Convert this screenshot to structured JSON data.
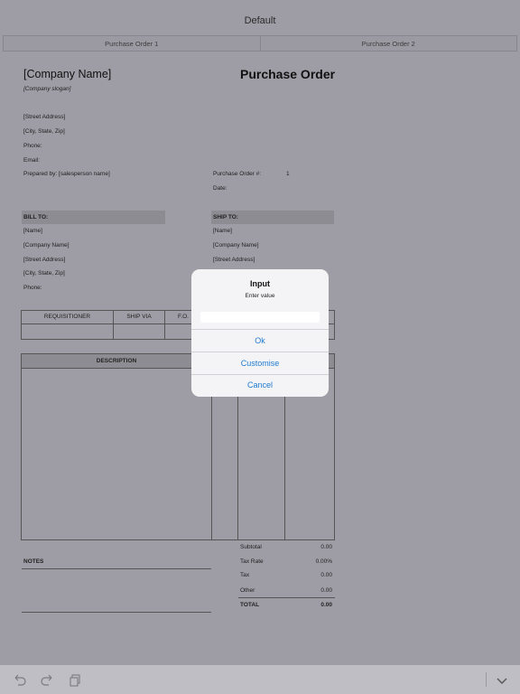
{
  "window": {
    "title": "Default"
  },
  "tabs": [
    {
      "label": "Purchase Order 1"
    },
    {
      "label": "Purchase Order 2"
    }
  ],
  "document": {
    "company_name": "[Company Name]",
    "company_slogan": "[Company slogan]",
    "doc_title": "Purchase Order",
    "address_lines": [
      "[Street Address]",
      "[City, State,  Zip]",
      "Phone:",
      "Email:"
    ],
    "prepared_by": "Prepared by: [salesperson name]",
    "po_number_label": "Purchase Order #:",
    "po_number_value": "1",
    "date_label": "Date:",
    "bill_to": {
      "header": "BILL TO:",
      "lines": [
        "[Name]",
        "[Company Name]",
        "[Street Address]",
        "[City, State,  Zip]",
        "Phone:"
      ]
    },
    "ship_to": {
      "header": "SHIP TO:",
      "lines": [
        "[Name]",
        "[Company Name]",
        "[Street Address]"
      ]
    },
    "shipping_table": {
      "headers": [
        "REQUISITIONER",
        "SHIP VIA",
        "F.O."
      ]
    },
    "items_table": {
      "headers": [
        "DESCRIPTION"
      ]
    },
    "totals": [
      {
        "label": "Subtotal",
        "value": "0.00"
      },
      {
        "label": "Tax Rate",
        "value": "0.00%"
      },
      {
        "label": "Tax",
        "value": "0.00"
      },
      {
        "label": "Other",
        "value": "0.00"
      },
      {
        "label": "TOTAL",
        "value": "0.00"
      }
    ],
    "notes_label": "NOTES"
  },
  "dialog": {
    "title": "Input",
    "message": "Enter value",
    "input_value": "",
    "buttons": {
      "ok": "Ok",
      "customise": "Customise",
      "cancel": "Cancel"
    }
  },
  "toolbar": {
    "icons": [
      "undo-icon",
      "redo-icon",
      "copy-icon",
      "chevron-down-icon"
    ]
  },
  "colors": {
    "overlay": "#9e9da5",
    "accent": "#1f7ad0",
    "dialog_bg": "#f4f4f6"
  }
}
